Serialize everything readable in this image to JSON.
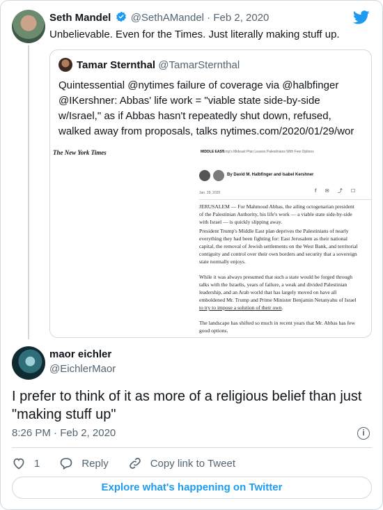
{
  "tweet": {
    "author_name": "Seth Mandel",
    "author_handle": "@SethAMandel",
    "date": "· Feb 2, 2020",
    "text": "Unbelievable. Even for the Times. Just literally making stuff up."
  },
  "quote": {
    "author_name": "Tamar Sternthal",
    "author_handle": "@TamarSternthal",
    "text": "Quintessential @nytimes failure of coverage via @halbfinger @IKershner: Abbas' life work = \"viable state side-by-side w/Israel,\" as if Abbas hasn't repeatedly shut down, refused, walked away from proposals, talks nytimes.com/2020/01/29/wor …"
  },
  "article": {
    "masthead": "The New York Times",
    "section": "MIDDLE EAST",
    "small_headline": "Trump's Mideast Plan Leaves Palestinians With Few Options",
    "byline": "By David M. Halbfinger and Isabel Kershner",
    "date": "Jan. 29, 2020",
    "share_icons": "f ✉ ⤴ ☐",
    "p1": "JERUSALEM — For Mahmoud Abbas, the ailing octogenarian president of the Palestinian Authority, his life's work — a viable state side-by-side with Israel — is quickly slipping away.",
    "p2": "President Trump's Middle East plan deprives the Palestinians of nearly everything they had been fighting for: East Jerusalem as their national capital, the removal of Jewish settlements on the West Bank, and territorial contiguity and control over their own borders and security that a sovereign state normally enjoys.",
    "p3_before": "While it was always presumed that such a state would be forged through talks with the Israelis, years of failure, a weak and divided Palestinian leadership, and an Arab world that has largely moved on have all emboldened Mr. Trump and Prime Minister Benjamin Netanyahu of Israel ",
    "p3_link": "to try to impose a solution of their own",
    "p3_after": ".",
    "p4": "The landscape has shifted so much in recent years that Mr. Abbas has few good options."
  },
  "reply": {
    "author_name": "maor eichler",
    "author_handle": "@EichlerMaor",
    "text": "I prefer to think of it as more of a religious belief than just \"making stuff up\"",
    "timestamp": "8:26 PM · Feb 2, 2020",
    "info_glyph": "i",
    "like_count": "1",
    "reply_label": "Reply",
    "copy_link_label": "Copy link to Tweet",
    "explore_label": "Explore what's happening on Twitter"
  },
  "colors": {
    "accent": "#1d9bf0",
    "text": "#0f1419",
    "secondary": "#536471",
    "border": "#cfd9de"
  }
}
